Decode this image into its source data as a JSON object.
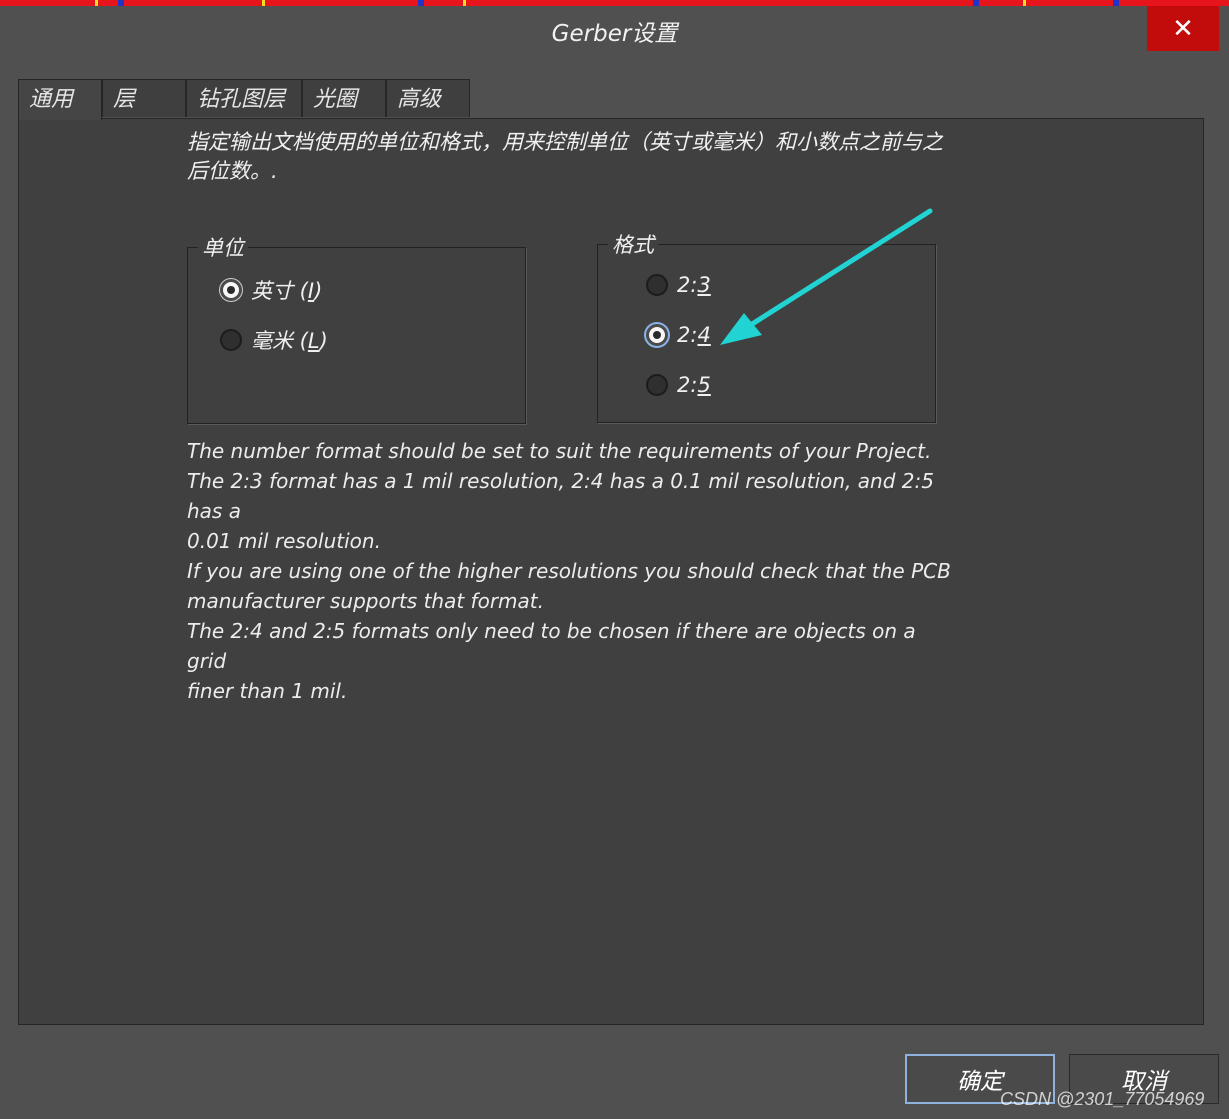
{
  "dialog": {
    "title": "Gerber设置",
    "close_label": "✕"
  },
  "tabs": [
    {
      "label": "通用",
      "active": true
    },
    {
      "label": "层",
      "active": false
    },
    {
      "label": "钻孔图层",
      "active": false
    },
    {
      "label": "光圈",
      "active": false
    },
    {
      "label": "高级",
      "active": false
    }
  ],
  "intro": {
    "line1": "指定输出文档使用的单位和格式，用来控制单位（英寸或毫米）和小数点之前与之",
    "line2": "后位数。."
  },
  "units": {
    "legend": "单位",
    "options": [
      {
        "label": "英寸",
        "shortcut": "I",
        "checked": true
      },
      {
        "label": "毫米",
        "shortcut": "L",
        "checked": false
      }
    ]
  },
  "format": {
    "legend": "格式",
    "options": [
      {
        "prefix": "2:",
        "shortcut": "3",
        "checked": false
      },
      {
        "prefix": "2:",
        "shortcut": "4",
        "checked": true
      },
      {
        "prefix": "2:",
        "shortcut": "5",
        "checked": false
      }
    ]
  },
  "description": [
    "The number format should be set to suit the requirements of your Project.",
    "The 2:3 format has a 1 mil resolution, 2:4 has a 0.1 mil resolution, and 2:5 has a",
    "0.01 mil resolution.",
    "If you are using one of the higher resolutions you should check that the PCB",
    "manufacturer supports that format.",
    "The 2:4 and 2:5 formats only need to be chosen if there are objects on a grid",
    "finer than 1 mil."
  ],
  "buttons": {
    "ok": "确定",
    "cancel": "取消"
  },
  "watermark": "CSDN @2301_77054969",
  "colors": {
    "arrow": "#22d3d3",
    "close_bg": "#c20c0c",
    "background": "#505050",
    "panel": "#404040"
  }
}
